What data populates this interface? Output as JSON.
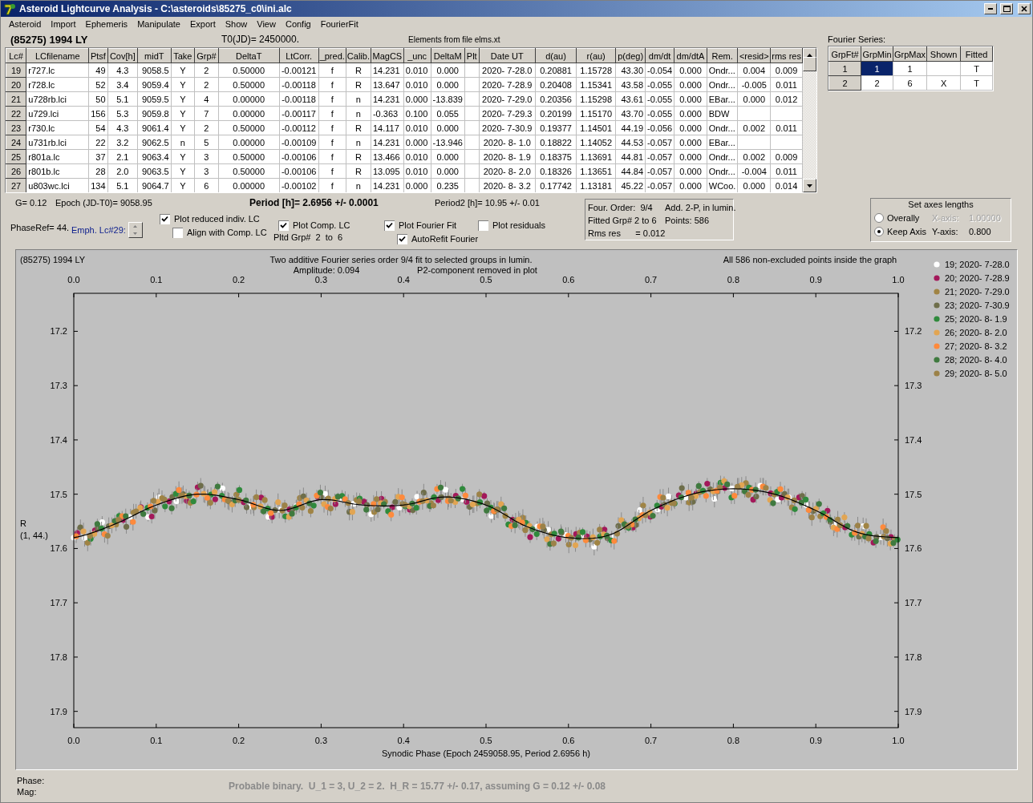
{
  "window": {
    "title": "Asteroid Lightcurve Analysis - C:\\asteroids\\85275_c0\\ini.alc"
  },
  "menu": [
    "Asteroid",
    "Import",
    "Ephemeris",
    "Manipulate",
    "Export",
    "Show",
    "View",
    "Config",
    "FourierFit"
  ],
  "header": {
    "object": "(85275) 1994 LY",
    "t0": "T0(JD)= 2450000.",
    "elements": "Elements from file elms.xt"
  },
  "table": {
    "columns": [
      "Lc#",
      "LCfilename",
      "Ptsf",
      "Cov[h]",
      "midT",
      "Take",
      "Grp#",
      "DeltaT",
      "LtCorr.",
      "_pred.",
      "Calib.",
      "MagCS",
      "_unc",
      "DeltaM",
      "Plt",
      "Date UT",
      "d(au)",
      "r(au)",
      "p(deg)",
      "dm/dt",
      "dm/dtA",
      "Rem.",
      "<resid>",
      "rms res"
    ],
    "rows": [
      [
        "19",
        "r727.lc",
        "49",
        "4.3",
        "9058.5",
        "Y",
        "2",
        "0.50000",
        "-0.00121",
        "f",
        "R",
        "14.231",
        "0.010",
        "0.000",
        null,
        "2020- 7-28.0",
        "0.20881",
        "1.15728",
        "43.30",
        "-0.054",
        "0.000",
        "Ondr...",
        "0.004",
        "0.009"
      ],
      [
        "20",
        "r728.lc",
        "52",
        "3.4",
        "9059.4",
        "Y",
        "2",
        "0.50000",
        "-0.00118",
        "f",
        "R",
        "13.647",
        "0.010",
        "0.000",
        null,
        "2020- 7-28.9",
        "0.20408",
        "1.15341",
        "43.58",
        "-0.055",
        "0.000",
        "Ondr...",
        "-0.005",
        "0.011"
      ],
      [
        "21",
        "u728rb.lci",
        "50",
        "5.1",
        "9059.5",
        "Y",
        "4",
        "0.00000",
        "-0.00118",
        "f",
        "n",
        "14.231",
        "0.000",
        "-13.839",
        null,
        "2020- 7-29.0",
        "0.20356",
        "1.15298",
        "43.61",
        "-0.055",
        "0.000",
        "EBar...",
        "0.000",
        "0.012"
      ],
      [
        "22",
        "u729.lci",
        "156",
        "5.3",
        "9059.8",
        "Y",
        "7",
        "0.00000",
        "-0.00117",
        "f",
        "n",
        "-0.363",
        "0.100",
        "0.055",
        null,
        "2020- 7-29.3",
        "0.20199",
        "1.15170",
        "43.70",
        "-0.055",
        "0.000",
        "BDW",
        null,
        null
      ],
      [
        "23",
        "r730.lc",
        "54",
        "4.3",
        "9061.4",
        "Y",
        "2",
        "0.50000",
        "-0.00112",
        "f",
        "R",
        "14.117",
        "0.010",
        "0.000",
        null,
        "2020- 7-30.9",
        "0.19377",
        "1.14501",
        "44.19",
        "-0.056",
        "0.000",
        "Ondr...",
        "0.002",
        "0.011"
      ],
      [
        "24",
        "u731rb.lci",
        "22",
        "3.2",
        "9062.5",
        "n",
        "5",
        "0.00000",
        "-0.00109",
        "f",
        "n",
        "14.231",
        "0.000",
        "-13.946",
        null,
        "2020- 8- 1.0",
        "0.18822",
        "1.14052",
        "44.53",
        "-0.057",
        "0.000",
        "EBar...",
        null,
        null
      ],
      [
        "25",
        "r801a.lc",
        "37",
        "2.1",
        "9063.4",
        "Y",
        "3",
        "0.50000",
        "-0.00106",
        "f",
        "R",
        "13.466",
        "0.010",
        "0.000",
        null,
        "2020- 8- 1.9",
        "0.18375",
        "1.13691",
        "44.81",
        "-0.057",
        "0.000",
        "Ondr...",
        "0.002",
        "0.009"
      ],
      [
        "26",
        "r801b.lc",
        "28",
        "2.0",
        "9063.5",
        "Y",
        "3",
        "0.50000",
        "-0.00106",
        "f",
        "R",
        "13.095",
        "0.010",
        "0.000",
        null,
        "2020- 8- 2.0",
        "0.18326",
        "1.13651",
        "44.84",
        "-0.057",
        "0.000",
        "Ondr...",
        "-0.004",
        "0.011"
      ],
      [
        "27",
        "u803wc.lci",
        "134",
        "5.1",
        "9064.7",
        "Y",
        "6",
        "0.00000",
        "-0.00102",
        "f",
        "n",
        "14.231",
        "0.000",
        "0.235",
        null,
        "2020- 8- 3.2",
        "0.17742",
        "1.13181",
        "45.22",
        "-0.057",
        "0.000",
        "WCoo.",
        "0.000",
        "0.014"
      ]
    ]
  },
  "fourier_series": {
    "label": "Fourier Series:",
    "columns": [
      "GrpFt#",
      "GrpMin",
      "GrpMax",
      "Shown",
      "Fitted"
    ],
    "rows": [
      {
        "grp_ft": "1",
        "grp_min": "1",
        "grp_max": "1",
        "fitted": "T",
        "selected": true
      },
      {
        "grp_ft": "2",
        "grp_min": "2",
        "grp_max": "6",
        "shown": "X",
        "fitted": "T",
        "selected": false
      }
    ]
  },
  "parameters": {
    "g": "G= 0.12",
    "epoch": "Epoch (JD-T0)= 9058.95",
    "period": "Period [h]= 2.6956 +/- 0.0001",
    "period2": "Period2 [h]= 10.95 +/- 0.01",
    "phase_ref": "PhaseRef= 44.",
    "emph": "Emph. Lc#29:",
    "pltd_grp": "Pltd Grp#  2  to  6"
  },
  "options": [
    {
      "label": "Plot reduced indiv. LC",
      "checked": true
    },
    {
      "label": "Align with Comp. LC",
      "checked": false
    },
    {
      "label": "Plot Comp. LC",
      "checked": true
    },
    {
      "label": "Plot Fourier Fit",
      "checked": true
    },
    {
      "label": "AutoRefit Fourier",
      "checked": true
    },
    {
      "label": "Plot residuals",
      "checked": false
    }
  ],
  "fit_info": [
    "Four. Order:  9/4",
    "Add. 2-P, in lumin.",
    "Fitted Grp# 2 to 6",
    "Points: 586",
    "Rms res      = 0.012"
  ],
  "axes": {
    "title": "Set axes lengths",
    "options": [
      {
        "label": "Overally",
        "selected": false,
        "axis_label": "X-axis:",
        "value": "1.00000",
        "disabled": true
      },
      {
        "label": "Keep Axis",
        "selected": true,
        "axis_label": "Y-axis:",
        "value": "0.800",
        "disabled": false
      }
    ]
  },
  "plot": {
    "object": "(85275) 1994 LY",
    "title": "Two additive Fourier series order 9/4 fit to selected groups in lumin.",
    "amplitude": "Amplitude: 0.094",
    "note": "P2-component removed in plot",
    "points_note": "All 586 non-excluded points inside the graph",
    "y_sublabel": "(1, 44.)",
    "legend": [
      {
        "label": "19; 2020- 7-28.0",
        "color": "#ffffff"
      },
      {
        "label": "20; 2020- 7-28.9",
        "color": "#a3185a"
      },
      {
        "label": "21; 2020- 7-29.0",
        "color": "#a08444"
      },
      {
        "label": "23; 2020- 7-30.9",
        "color": "#6e6e4a"
      },
      {
        "label": "25; 2020- 8- 1.9",
        "color": "#2f8a3c"
      },
      {
        "label": "26; 2020- 8- 2.0",
        "color": "#e2a552"
      },
      {
        "label": "27; 2020- 8- 3.2",
        "color": "#ff8a3c"
      },
      {
        "label": "28; 2020- 8- 4.0",
        "color": "#3f7a3f"
      },
      {
        "label": "29; 2020- 8- 5.0",
        "color": "#9c8248"
      }
    ],
    "chart_data": {
      "type": "line",
      "xlabel": "Synodic Phase (Epoch 2459058.95, Period 2.6956 h)",
      "ylabel": "R",
      "x": [
        0,
        0.05,
        0.1,
        0.15,
        0.2,
        0.25,
        0.3,
        0.35,
        0.4,
        0.45,
        0.5,
        0.55,
        0.6,
        0.65,
        0.7,
        0.75,
        0.8,
        0.85,
        0.9,
        0.95,
        1
      ],
      "series": [
        {
          "color": "#000000",
          "values": [
            17.58,
            17.555,
            17.52,
            17.5,
            17.51,
            17.53,
            17.51,
            17.52,
            17.52,
            17.505,
            17.52,
            17.56,
            17.58,
            17.575,
            17.53,
            17.5,
            17.49,
            17.5,
            17.53,
            17.57,
            17.58
          ]
        }
      ],
      "xlim": [
        0,
        1
      ],
      "ylim": [
        17.93,
        17.13
      ],
      "x2lim": [
        0,
        1
      ],
      "y2lim": [
        17.93,
        17.13
      ],
      "xticks": [
        {
          "value": 0,
          "label": "0.0"
        },
        {
          "value": 0.1,
          "label": "0.1"
        },
        {
          "value": 0.2,
          "label": "0.2"
        },
        {
          "value": 0.3,
          "label": "0.3"
        },
        {
          "value": 0.4,
          "label": "0.4"
        },
        {
          "value": 0.5,
          "label": "0.5"
        },
        {
          "value": 0.6,
          "label": "0.6"
        },
        {
          "value": 0.7,
          "label": "0.7"
        },
        {
          "value": 0.8,
          "label": "0.8"
        },
        {
          "value": 0.9,
          "label": "0.9"
        },
        {
          "value": 1,
          "label": "1.0"
        }
      ],
      "x2ticks": [
        {
          "value": 0,
          "label": "0.0"
        },
        {
          "value": 0.1,
          "label": "0.1"
        },
        {
          "value": 0.2,
          "label": "0.2"
        },
        {
          "value": 0.3,
          "label": "0.3"
        },
        {
          "value": 0.4,
          "label": "0.4"
        },
        {
          "value": 0.5,
          "label": "0.5"
        },
        {
          "value": 0.6,
          "label": "0.6"
        },
        {
          "value": 0.7,
          "label": "0.7"
        },
        {
          "value": 0.8,
          "label": "0.8"
        },
        {
          "value": 0.9,
          "label": "0.9"
        },
        {
          "value": 1,
          "label": "1.0"
        }
      ],
      "yticks": [
        17.2,
        17.3,
        17.4,
        17.5,
        17.6,
        17.7,
        17.8,
        17.9
      ],
      "y2ticks": [
        17.2,
        17.3,
        17.4,
        17.5,
        17.6,
        17.7,
        17.8,
        17.9
      ]
    }
  },
  "footer": {
    "phase": "Phase:",
    "mag": "Mag:",
    "result": "Probable binary.  U_1 = 3, U_2 = 2.  H_R = 15.77 +/- 0.17, assuming G = 0.12 +/- 0.08"
  }
}
